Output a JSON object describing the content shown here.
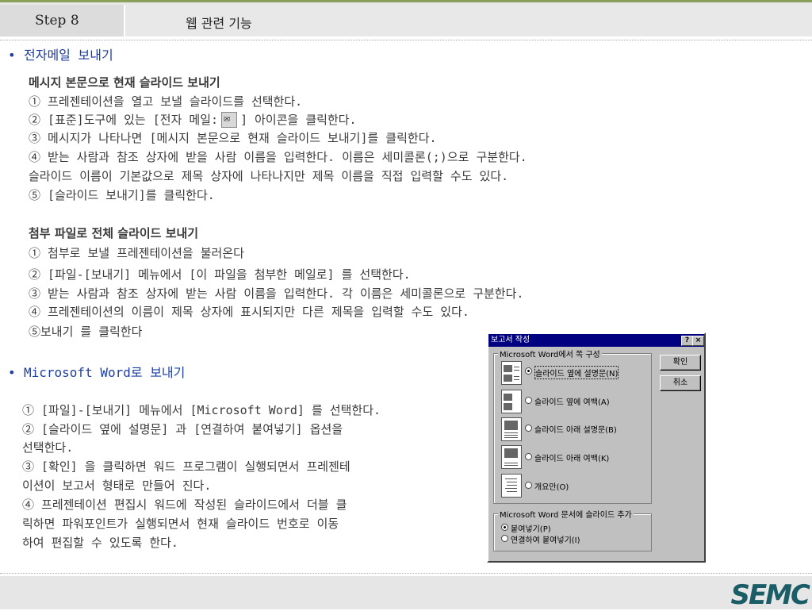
{
  "header": {
    "step": "Step 8",
    "title": "웹 관련 기능"
  },
  "section1": {
    "bullet": "•",
    "heading": "전자메일 보내기",
    "sub1_title": "메시지 본문으로 현재 슬라이드 보내기",
    "sub1_lines": [
      "① 프레젠테이션을 열고 보낼 슬라이드를 선택한다.",
      "② [표준]도구에 있는 [전자 메일:",
      "] 아이콘을 클릭한다.",
      "③ 메시지가 나타나면 [메시지 본문으로 현재 슬라이드 보내기]를 클릭한다.",
      "④ 받는 사람과 참조 상자에 받을 사람 이름을 입력한다. 이름은 세미콜론(;)으로 구분한다.",
      "슬라이드 이름이 기본값으로 제목 상자에 나타나지만 제목 이름을 직접 입력할 수도 있다.",
      "⑤ [슬라이드 보내기]를 클릭한다."
    ],
    "sub2_title": "첨부 파일로 전체 슬라이드 보내기",
    "sub2_lines": [
      "① 첨부로 보낼 프레젠테이션을 불러온다",
      "② [파일-[보내기] 메뉴에서 [이 파일을 첨부한 메일로] 를 선택한다.",
      "③ 받는 사람과 참조 상자에 받는 사람 이름을 입력한다. 각 이름은 세미콜론으로 구분한다.",
      "④ 프레젠테이션의 이름이 제목 상자에 표시되지만 다른 제목을 입력할 수도 있다.",
      "⑤보내기 를 클릭한다"
    ]
  },
  "section2": {
    "bullet": "•",
    "heading": "Microsoft Word로 보내기",
    "lines": [
      "① [파일]-[보내기] 메뉴에서 [Microsoft Word] 를 선택한다.",
      "② [슬라이드 옆에 설명문] 과 [연결하여 붙여넣기] 옵션을",
      "선택한다.",
      "③ [확인] 을 클릭하면 워드 프로그램이 실행되면서 프레젠테",
      "이션이 보고서 형태로 만들어 진다.",
      "④ 프레젠테이션 편집시 워드에 작성된 슬라이드에서 더블 클",
      "릭하면 파워포인트가 실행되면서 현재 슬라이드 번호로 이동",
      "하여 편집할 수 있도록 한다."
    ]
  },
  "dialog": {
    "title": "보고서 작성",
    "help": "?",
    "close": "×",
    "group1": "Microsoft Word에서 쪽 구성",
    "options": [
      "슬라이드 옆에 설명문(N)",
      "슬라이드 옆에 여백(A)",
      "슬라이드 아래 설명문(B)",
      "슬라이드 아래 여백(K)",
      "개요만(O)"
    ],
    "ok": "확인",
    "cancel": "취소",
    "group2": "Microsoft Word  문서에 슬라이드 추가",
    "paste_options": [
      "붙여넣기(P)",
      "연결하여 붙여넣기(I)"
    ]
  },
  "footer": {
    "logo": "SEMC"
  }
}
